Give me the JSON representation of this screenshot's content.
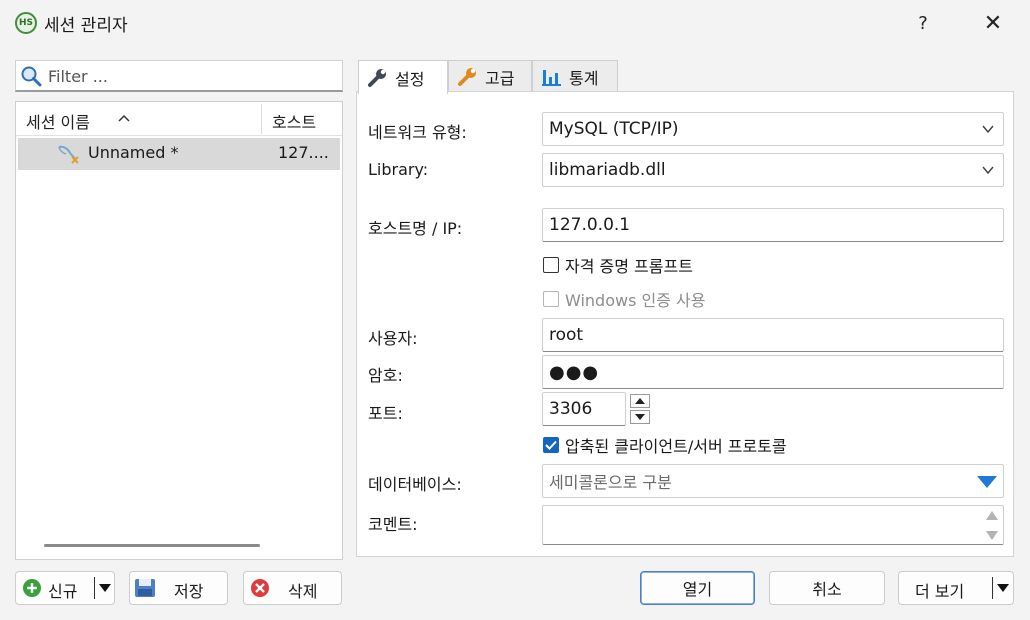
{
  "window": {
    "title": "세션 관리자",
    "app_icon_text": "HS",
    "help_label": "?",
    "close_label": "✕"
  },
  "filter": {
    "placeholder": "Filter ..."
  },
  "session_list": {
    "columns": [
      "세션 이름",
      "호스트"
    ],
    "sort_indicator": "^",
    "rows": [
      {
        "name": "Unnamed *",
        "host": "127...."
      }
    ]
  },
  "tabs": [
    {
      "label": "설정",
      "icon": "wrench-icon",
      "active": true
    },
    {
      "label": "고급",
      "icon": "wrench-orange-icon",
      "active": false
    },
    {
      "label": "통계",
      "icon": "bar-chart-icon",
      "active": false
    }
  ],
  "settings": {
    "network_type_label": "네트워크 유형:",
    "network_type_value": "MySQL (TCP/IP)",
    "library_label": "Library:",
    "library_value": "libmariadb.dll",
    "host_label": "호스트명 / IP:",
    "host_value": "127.0.0.1",
    "credential_prompt_label": "자격 증명 프롬프트",
    "credential_prompt_checked": false,
    "windows_auth_label": "Windows 인증 사용",
    "windows_auth_checked": false,
    "user_label": "사용자:",
    "user_value": "root",
    "password_label": "암호:",
    "password_value": "●●●",
    "port_label": "포트:",
    "port_value": "3306",
    "compressed_label": "압축된 클라이언트/서버 프로토콜",
    "compressed_checked": true,
    "database_label": "데이터베이스:",
    "database_placeholder": "세미콜론으로 구분",
    "comment_label": "코멘트:",
    "comment_value": ""
  },
  "buttons": {
    "new_label": "신규",
    "save_label": "저장",
    "delete_label": "삭제",
    "open_label": "열기",
    "cancel_label": "취소",
    "more_label": "더 보기"
  },
  "colors": {
    "accent": "#1565c0",
    "dropdown_arrow": "#1e7ad6",
    "new_green": "#3aa23a",
    "delete_red": "#e03a3a",
    "selected_row": "#d9d9d9"
  }
}
